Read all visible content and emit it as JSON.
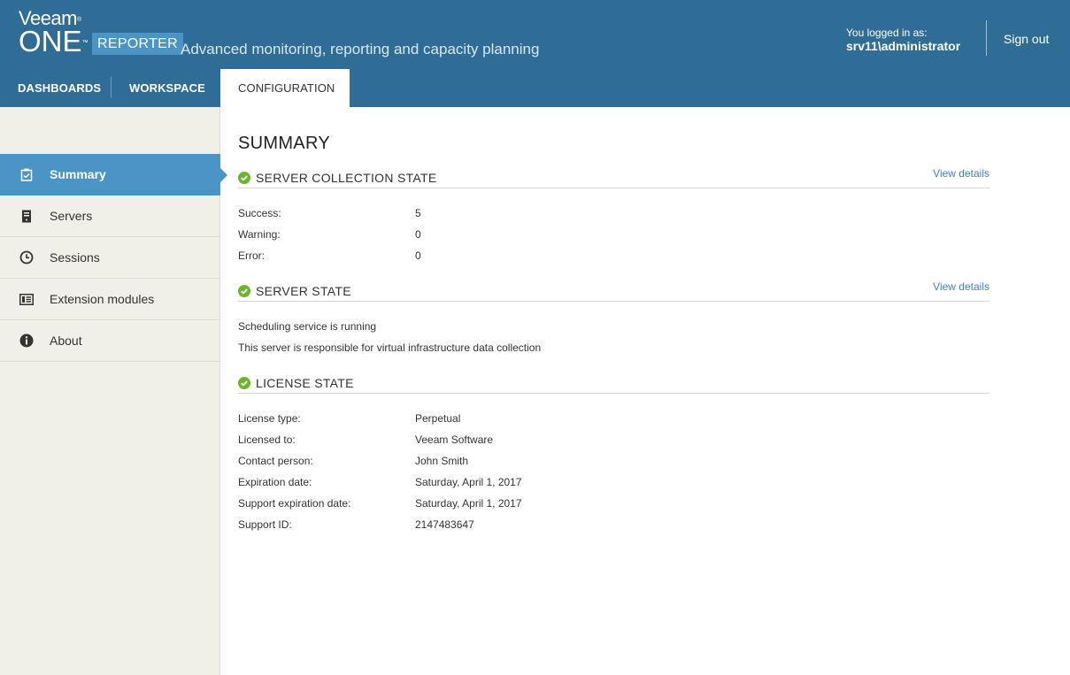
{
  "header": {
    "logo_veeam": "Veeam",
    "logo_one": "ONE",
    "logo_mark_registered": "®",
    "logo_mark_tm": "™",
    "product_badge": "REPORTER",
    "tagline": "Advanced monitoring, reporting and capacity planning",
    "user_label": "You logged in as:",
    "user_name": "srv11\\administrator",
    "signout_label": "Sign out"
  },
  "tabs": [
    {
      "label": "DASHBOARDS",
      "active": false
    },
    {
      "label": "WORKSPACE",
      "active": false
    },
    {
      "label": "CONFIGURATION",
      "active": true
    }
  ],
  "sidebar": {
    "items": [
      {
        "label": "Summary",
        "icon": "clipboard-check-icon",
        "active": true
      },
      {
        "label": "Servers",
        "icon": "server-icon",
        "active": false
      },
      {
        "label": "Sessions",
        "icon": "clock-icon",
        "active": false
      },
      {
        "label": "Extension modules",
        "icon": "module-icon",
        "active": false
      },
      {
        "label": "About",
        "icon": "info-icon",
        "active": false
      }
    ]
  },
  "main": {
    "title": "SUMMARY",
    "collection": {
      "title": "SERVER COLLECTION STATE",
      "link": "View details",
      "rows": [
        {
          "k": "Success:",
          "v": "5"
        },
        {
          "k": "Warning:",
          "v": "0"
        },
        {
          "k": "Error:",
          "v": "0"
        }
      ]
    },
    "server_state": {
      "title": "SERVER STATE",
      "link": "View details",
      "lines": [
        "Scheduling service is running",
        "This server is responsible for virtual infrastructure data collection"
      ]
    },
    "license": {
      "title": "LICENSE STATE",
      "rows": [
        {
          "k": "License type:",
          "v": "Perpetual"
        },
        {
          "k": "Licensed to:",
          "v": "Veeam Software"
        },
        {
          "k": "Contact person:",
          "v": "John Smith"
        },
        {
          "k": "Expiration date:",
          "v": "Saturday, April 1, 2017"
        },
        {
          "k": "Support expiration date:",
          "v": "Saturday, April 1, 2017"
        },
        {
          "k": "Support ID:",
          "v": "2147483647"
        }
      ]
    }
  },
  "colors": {
    "header_bg": "#2f6d96",
    "accent": "#4a94c6",
    "sidebar_bg": "#f0efe8",
    "status_ok": "#6cb52d",
    "link": "#3c86c0"
  }
}
